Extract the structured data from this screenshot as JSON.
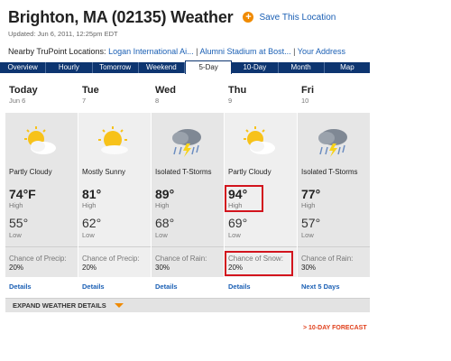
{
  "header": {
    "title": "Brighton, MA (02135) Weather",
    "save_label": "Save This Location",
    "updated": "Updated: Jun 6, 2011, 12:25pm EDT",
    "nearby_prefix": "Nearby TruPoint Locations:",
    "nearby_links": [
      "Logan International Ai...",
      "Alumni Stadium at Bost...",
      "Your Address"
    ]
  },
  "tabs": [
    "Overview",
    "Hourly",
    "Tomorrow",
    "Weekend",
    "5-Day",
    "10-Day",
    "Month",
    "Map"
  ],
  "active_tab": "5-Day",
  "days": [
    {
      "day": "Today",
      "date": "Jun 6",
      "icon": "partly-cloudy-icon",
      "condition": "Partly Cloudy",
      "high": "74°F",
      "high_label": "High",
      "low": "55°",
      "low_label": "Low",
      "precip_label": "Chance of Precip:",
      "precip_value": "20%",
      "details": "Details"
    },
    {
      "day": "Tue",
      "date": "7",
      "icon": "mostly-sunny-icon",
      "condition": "Mostly Sunny",
      "high": "81°",
      "high_label": "High",
      "low": "62°",
      "low_label": "Low",
      "precip_label": "Chance of Precip:",
      "precip_value": "20%",
      "details": "Details"
    },
    {
      "day": "Wed",
      "date": "8",
      "icon": "isolated-tstorms-icon",
      "condition": "Isolated T-Storms",
      "high": "89°",
      "high_label": "High",
      "low": "68°",
      "low_label": "Low",
      "precip_label": "Chance of Rain:",
      "precip_value": "30%",
      "details": "Details"
    },
    {
      "day": "Thu",
      "date": "9",
      "icon": "partly-cloudy-icon",
      "condition": "Partly Cloudy",
      "high": "94°",
      "high_label": "High",
      "low": "69°",
      "low_label": "Low",
      "precip_label": "Chance of Snow:",
      "precip_value": "20%",
      "details": "Details"
    },
    {
      "day": "Fri",
      "date": "10",
      "icon": "isolated-tstorms-icon",
      "condition": "Isolated T-Storms",
      "high": "77°",
      "high_label": "High",
      "low": "57°",
      "low_label": "Low",
      "precip_label": "Chance of Rain:",
      "precip_value": "30%",
      "details": "Next 5 Days"
    }
  ],
  "expand_label": "EXPAND WEATHER DETAILS",
  "ten_day_link": "> 10-DAY FORECAST",
  "colors": {
    "accent": "#f08a00",
    "nav": "#0d3570",
    "link": "#1a5fb4",
    "highlight": "#d2141d"
  }
}
